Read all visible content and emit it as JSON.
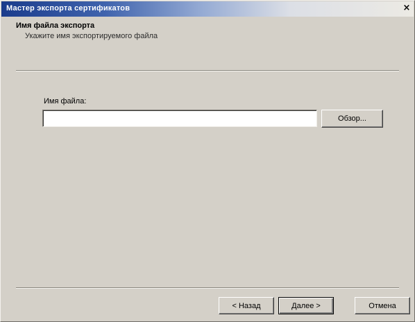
{
  "window": {
    "title": "Мастер экспорта сертификатов",
    "close_symbol": "×"
  },
  "header": {
    "title": "Имя файла экспорта",
    "subtitle": "Укажите имя экспортируемого файла"
  },
  "form": {
    "file_label": "Имя файла:",
    "file_value": "",
    "browse_label": "Обзор..."
  },
  "footer": {
    "back_label": "< Назад",
    "next_label": "Далее >",
    "cancel_label": "Отмена"
  },
  "colors": {
    "titlebar_start": "#1b3c8c",
    "face": "#d4d0c8"
  },
  "icons": {
    "close": "close-icon"
  }
}
